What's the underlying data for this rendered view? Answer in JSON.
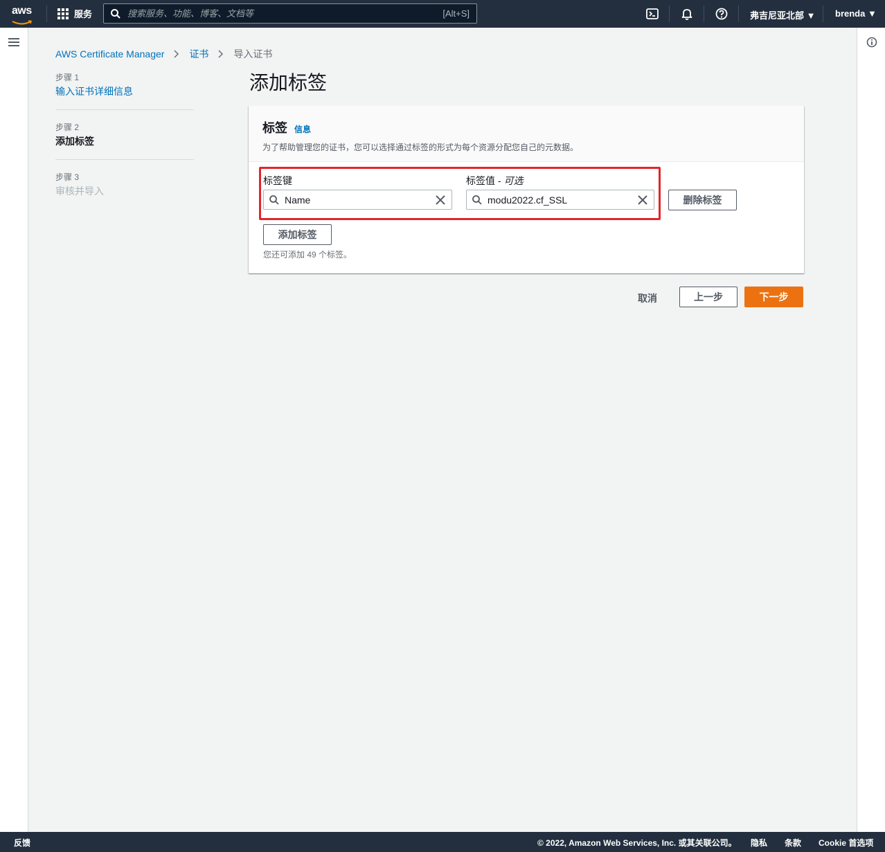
{
  "topnav": {
    "logo_text": "aws",
    "services_label": "服务",
    "search_placeholder": "搜索服务、功能、博客、文档等",
    "search_shortcut": "[Alt+S]",
    "region": "弗吉尼亚北部 ▼",
    "user": "brenda ▼"
  },
  "breadcrumb": {
    "items": [
      "AWS Certificate Manager",
      "证书",
      "导入证书"
    ]
  },
  "steps": [
    {
      "num": "步骤 1",
      "label": "输入证书详细信息"
    },
    {
      "num": "步骤 2",
      "label": "添加标签"
    },
    {
      "num": "步骤 3",
      "label": "审核并导入"
    }
  ],
  "page_title": "添加标签",
  "panel": {
    "title": "标签",
    "info": "信息",
    "description": "为了帮助管理您的证书，您可以选择通过标签的形式为每个资源分配您自己的元数据。",
    "key_label": "标签键",
    "value_label": "标签值 - ",
    "value_optional": "可选",
    "key_value": "Name",
    "value_value": "modu2022.cf_SSL",
    "remove_button": "删除标签",
    "add_button": "添加标签",
    "hint": "您还可添加 49 个标签。"
  },
  "actions": {
    "cancel": "取消",
    "previous": "上一步",
    "next": "下一步"
  },
  "colors": {
    "nav_bg": "#232f3e",
    "primary": "#ec7211",
    "link": "#0073bb",
    "highlight": "#e3242b"
  },
  "footer": {
    "feedback": "反馈",
    "copyright": "© 2022, Amazon Web Services, Inc. 或其关联公司。",
    "privacy": "隐私",
    "terms": "条款",
    "cookie": "Cookie 首选项"
  }
}
